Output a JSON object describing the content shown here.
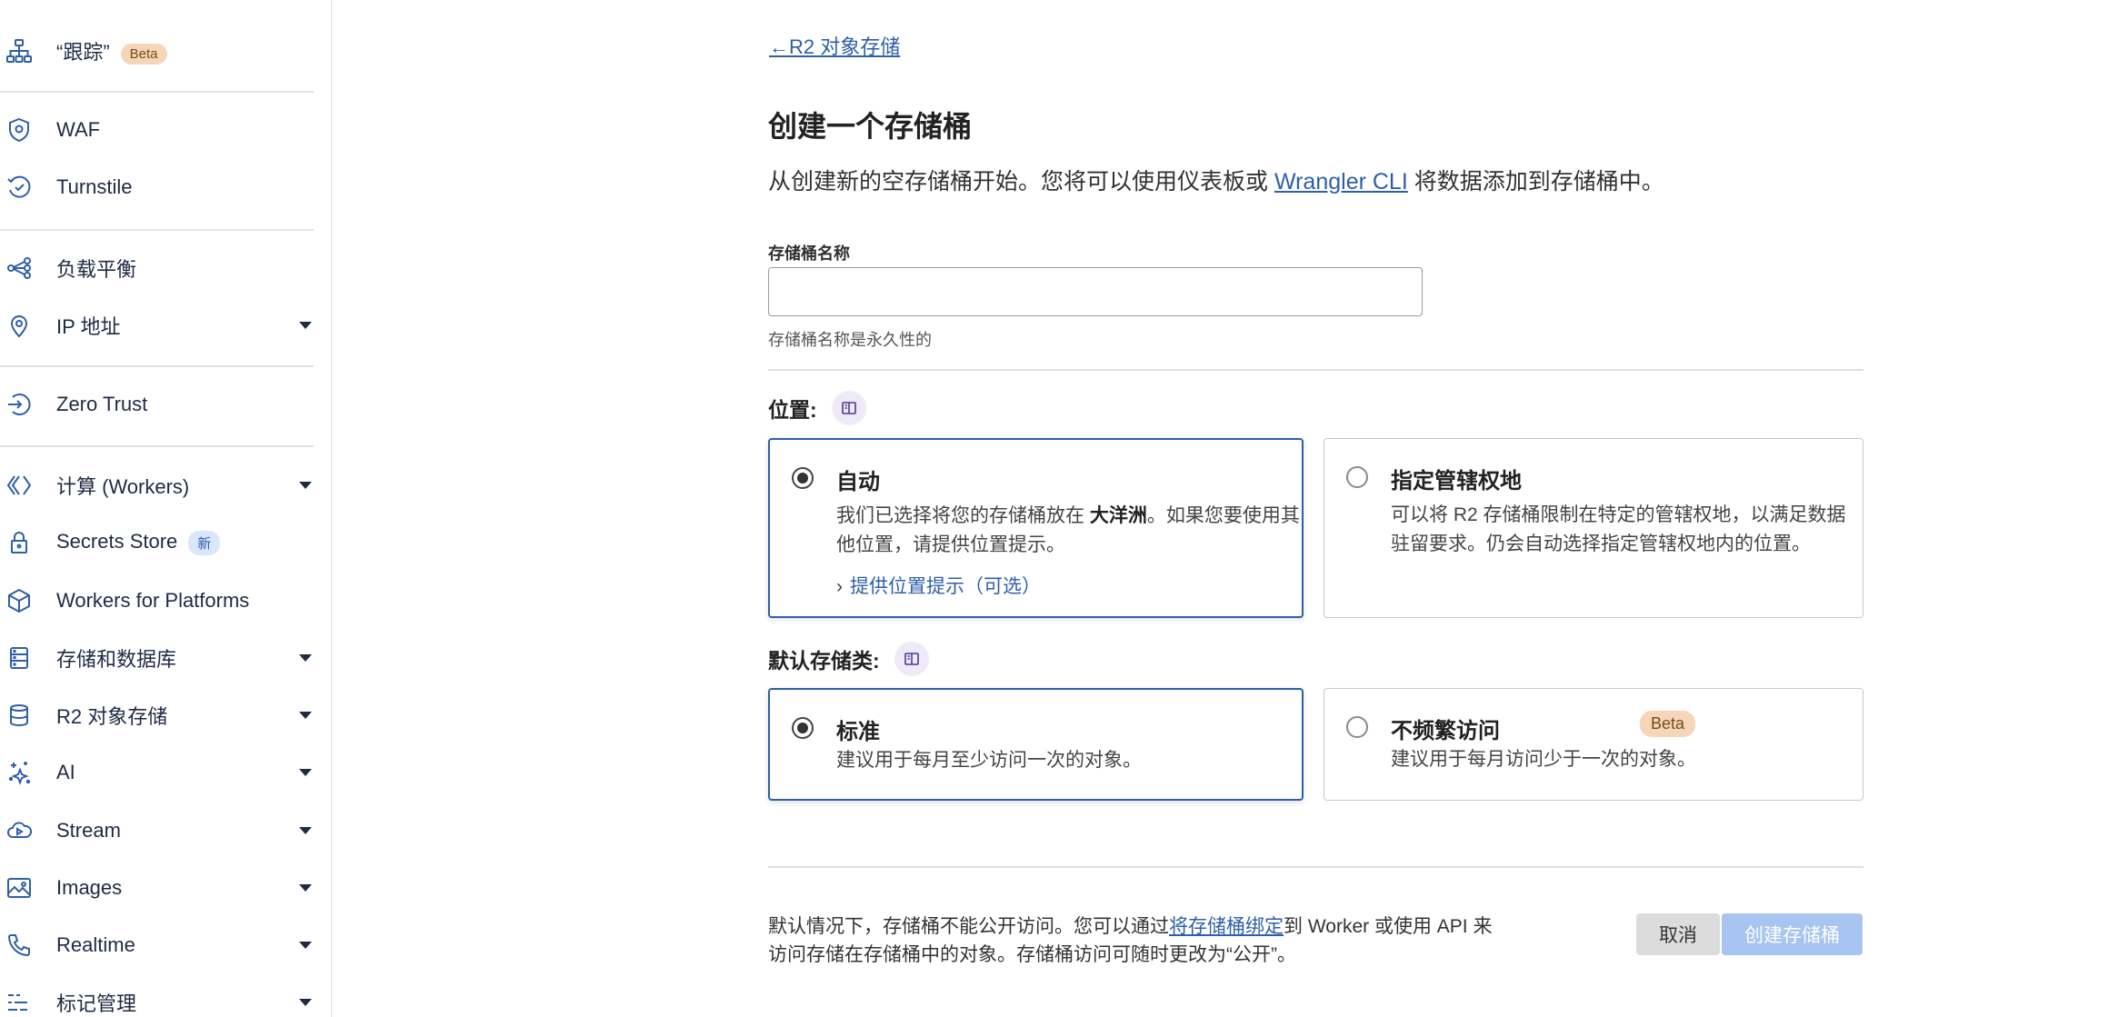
{
  "colors": {
    "accent": "#2f5fa8",
    "beta_badge_bg": "#f6d6b8",
    "new_badge_bg": "#d9e6fb",
    "create_button_disabled": "#a8c4f0",
    "cancel_button_bg": "#dcdcdc"
  },
  "sidebar": {
    "items": [
      {
        "label": "“跟踪”",
        "icon": "sitemap-icon",
        "badge": "Beta"
      },
      {
        "label": "WAF",
        "icon": "shield-gear-icon"
      },
      {
        "label": "Turnstile",
        "icon": "turnstile-icon"
      },
      {
        "label": "负载平衡",
        "icon": "load-balancer-icon"
      },
      {
        "label": "IP 地址",
        "icon": "location-pin-icon",
        "expandable": true
      },
      {
        "label": "Zero Trust",
        "icon": "zero-trust-icon"
      },
      {
        "label": "计算 (Workers)",
        "icon": "workers-icon",
        "expandable": true
      },
      {
        "label": "Secrets Store",
        "icon": "lock-icon",
        "badge": "新"
      },
      {
        "label": "Workers for Platforms",
        "icon": "cube-icon"
      },
      {
        "label": "存储和数据库",
        "icon": "database-icon",
        "expandable": true
      },
      {
        "label": "R2 对象存储",
        "icon": "r2-database-icon",
        "expandable": true
      },
      {
        "label": "AI",
        "icon": "sparkles-icon",
        "expandable": true
      },
      {
        "label": "Stream",
        "icon": "stream-cloud-icon",
        "expandable": true
      },
      {
        "label": "Images",
        "icon": "image-icon",
        "expandable": true
      },
      {
        "label": "Realtime",
        "icon": "phone-icon",
        "expandable": true
      },
      {
        "label": "标记管理",
        "icon": "tag-list-icon",
        "expandable": true
      }
    ]
  },
  "main": {
    "back_link": "R2 对象存储",
    "title": "创建一个存储桶",
    "description_pre": "从创建新的空存储桶开始。您将可以使用仪表板或 ",
    "description_link": "Wrangler CLI",
    "description_post": " 将数据添加到存储桶中。",
    "bucket_name": {
      "label": "存储桶名称",
      "value": "",
      "hint": "存储桶名称是永久性的"
    },
    "location": {
      "title": "位置:",
      "options": [
        {
          "title": "自动",
          "selected": true,
          "body_pre": "我们已选择将您的存储桶放在 ",
          "body_bold": "大洋洲",
          "body_post": "。如果您要使用其他位置，请提供位置提示。",
          "link": "提供位置提示（可选）"
        },
        {
          "title": "指定管辖权地",
          "selected": false,
          "body": "可以将 R2 存储桶限制在特定的管辖权地，以满足数据驻留要求。仍会自动选择指定管辖权地内的位置。"
        }
      ]
    },
    "storage_class": {
      "title": "默认存储类:",
      "options": [
        {
          "title": "标准",
          "selected": true,
          "body": "建议用于每月至少访问一次的对象。"
        },
        {
          "title": "不频繁访问",
          "selected": false,
          "badge": "Beta",
          "body": "建议用于每月访问少于一次的对象。"
        }
      ]
    },
    "footer": {
      "text_pre": "默认情况下，存储桶不能公开访问。您可以通过",
      "text_link": "将存储桶绑定",
      "text_post": "到 Worker 或使用 API 来访问存储在存储桶中的对象。存储桶访问可随时更改为“公开”。",
      "cancel_label": "取消",
      "create_label": "创建存储桶"
    }
  }
}
